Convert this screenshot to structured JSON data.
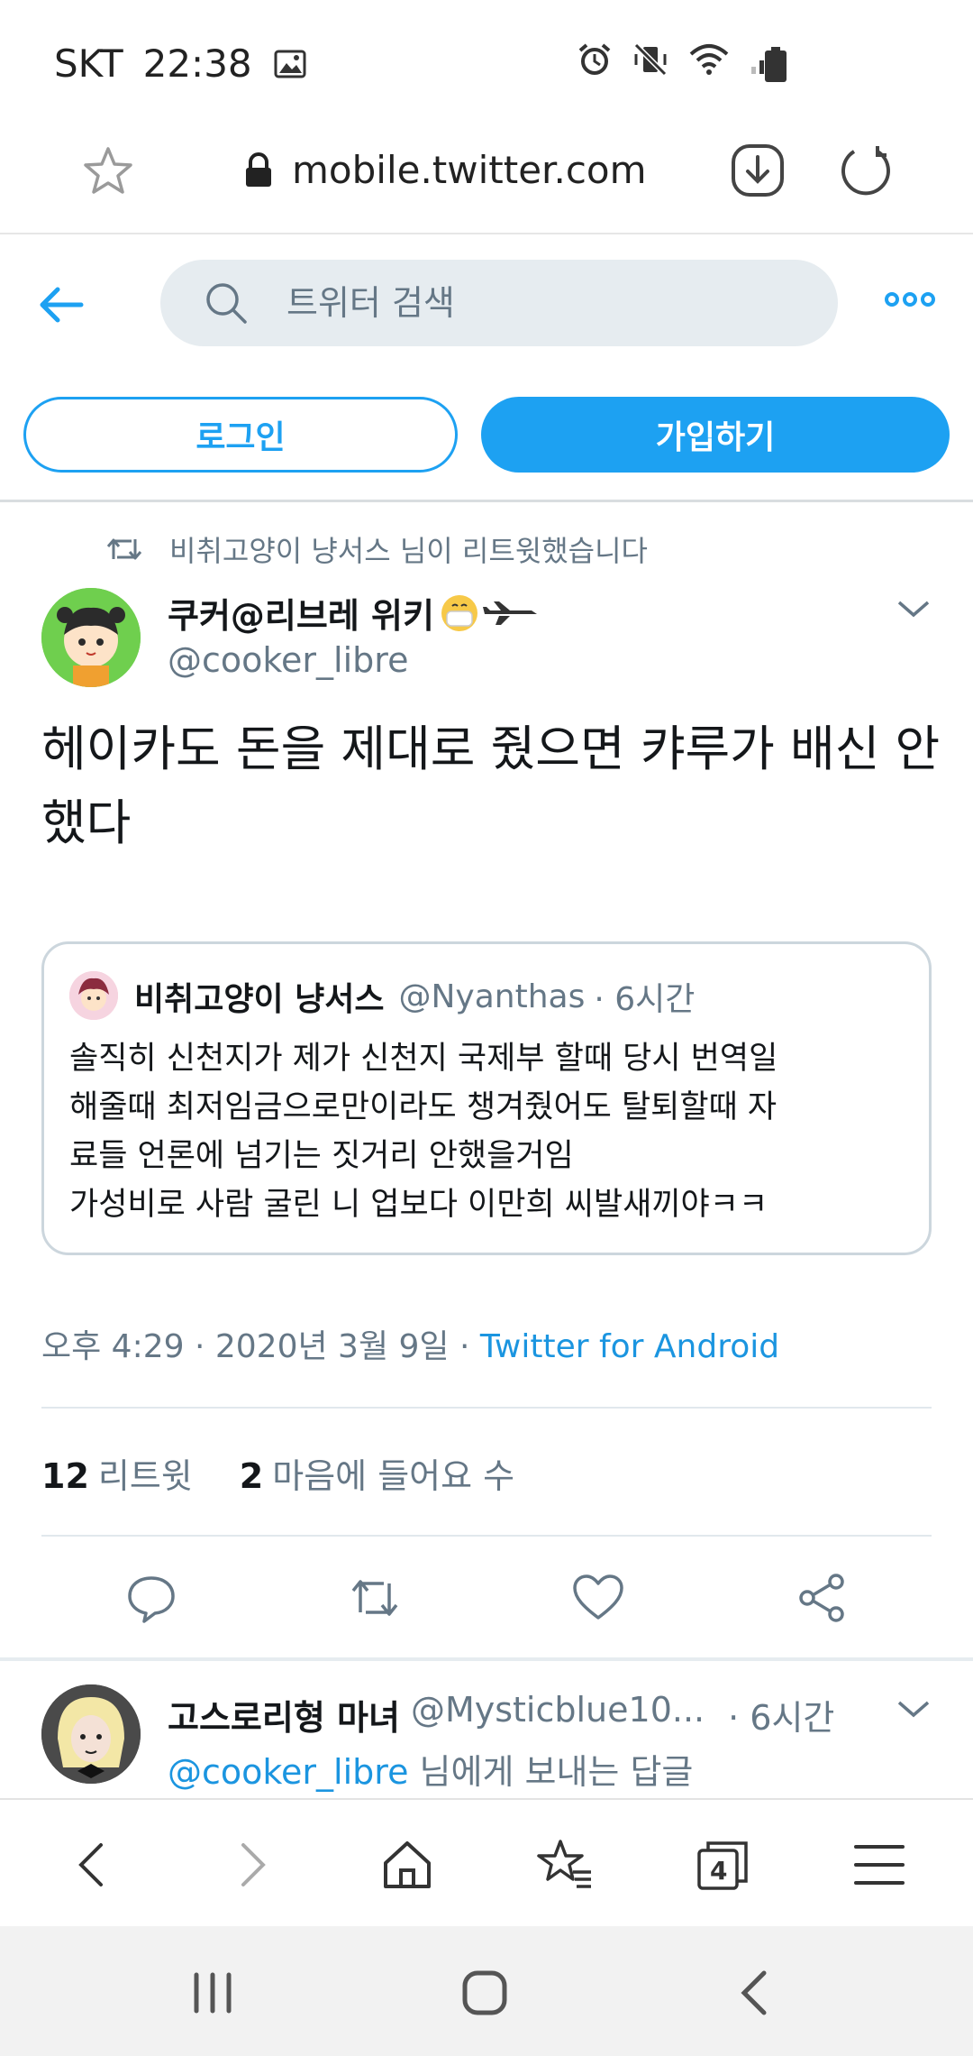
{
  "status_bar": {
    "carrier": "SKT",
    "time": "22:38",
    "icons": [
      "image-icon",
      "alarm-icon",
      "vibrate-mute-icon",
      "wifi-icon",
      "signal-icon",
      "battery-icon"
    ]
  },
  "browser": {
    "url": "mobile.twitter.com",
    "icons": [
      "star-icon",
      "lock-icon",
      "download-icon",
      "reload-icon"
    ]
  },
  "twitter_header": {
    "search_placeholder": "트위터 검색",
    "login_label": "로그인",
    "signup_label": "가입하기",
    "accent_color": "#1da1f2"
  },
  "tweet": {
    "retweet_context": "비취고양이 냥서스 님이 리트윗했습니다",
    "author_name": "쿠커@리브레 위키",
    "author_handle": "@cooker_libre",
    "text": "헤이카도 돈을 제대로 줬으면 캬루가 배신 안했다",
    "quote": {
      "name": "비취고양이 냥서스",
      "handle": "@Nyanthas",
      "time": "· 6시간",
      "lines": [
        "솔직히 신천지가 제가 신천지 국제부 할때 당시 번역일",
        "해줄때 최저임금으로만이라도 챙겨줬어도 탈퇴할때 자",
        "료들 언론에 넘기는 짓거리 안했을거임",
        "가성비로 사람 굴린 니 업보다 이만희 씨발새끼야ㅋㅋ"
      ]
    },
    "timestamp": "오후 4:29 · 2020년 3월 9일 ·",
    "source": "Twitter for Android",
    "retweets_count": "12",
    "retweets_label": "리트윗",
    "likes_count": "2",
    "likes_label": "마음에 들어요 수"
  },
  "reply": {
    "name": "고스로리형 마녀",
    "handle": "@Mysticblue10...",
    "time": "· 6시간",
    "mention": "@cooker_libre",
    "reply_suffix": "님에게 보내는 답글"
  },
  "browser_nav": {
    "tabs_count": "4"
  }
}
